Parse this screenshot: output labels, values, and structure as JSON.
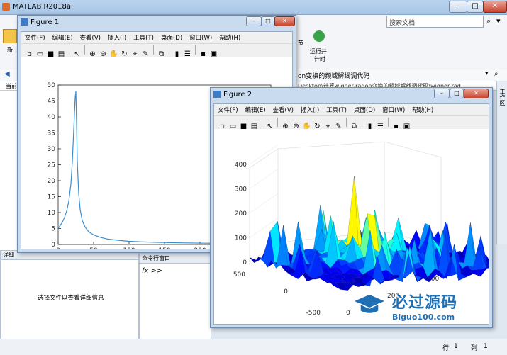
{
  "main": {
    "title": "MATLAB R2018a",
    "search_placeholder": "搜索文档",
    "ribbon_left_label": "新",
    "ribbon_right_1": "节",
    "ribbon_right_2": "运行并",
    "ribbon_right_3": "计时",
    "address_text": "on变换的频域解线调代码",
    "path_text": "Desktop\\计算wigner-radon变换的频域解线调代码\\wigner-rad",
    "current_folder_label": "当前",
    "detail_label": "详细",
    "detail_message": "选择文件以查看详细信息",
    "command_window_label": "命令行窗口",
    "prompt": "fx >>",
    "workspace_tab": "工作区",
    "status_row_label": "行",
    "status_row_value": "1",
    "status_col_label": "列",
    "status_col_value": "1",
    "watermark_brand": "必过源码",
    "watermark_url": "Biguo100.com"
  },
  "figure1": {
    "title": "Figure 1",
    "menus": [
      "文件(F)",
      "编辑(E)",
      "查看(V)",
      "插入(I)",
      "工具(T)",
      "桌面(D)",
      "窗口(W)",
      "帮助(H)"
    ]
  },
  "figure2": {
    "title": "Figure 2",
    "menus": [
      "文件(F)",
      "编辑(E)",
      "查看(V)",
      "插入(I)",
      "工具(T)",
      "桌面(D)",
      "窗口(W)",
      "帮助(H)"
    ]
  },
  "chart_data": [
    {
      "type": "line",
      "title": "",
      "xlabel": "",
      "ylabel": "",
      "xlim": [
        0,
        300
      ],
      "ylim": [
        0,
        50
      ],
      "xticks": [
        0,
        50,
        100,
        150,
        200
      ],
      "yticks": [
        0,
        5,
        10,
        15,
        20,
        25,
        30,
        35,
        40,
        45,
        50
      ],
      "color": "#3a8fd0",
      "x": [
        0,
        3,
        6,
        9,
        12,
        15,
        18,
        20,
        22,
        24,
        25,
        26,
        27,
        29,
        31,
        34,
        38,
        43,
        50,
        60,
        70,
        85,
        100,
        120,
        150,
        180,
        210,
        240
      ],
      "y": [
        5,
        6,
        7,
        8.5,
        10.5,
        13.5,
        19,
        26,
        36,
        46,
        48,
        38,
        26,
        16,
        11,
        7.5,
        5.5,
        4,
        3,
        2.2,
        1.7,
        1.3,
        1.0,
        0.8,
        0.6,
        0.5,
        0.4,
        0.35
      ]
    },
    {
      "type": "surface",
      "title": "",
      "zticks": [
        0,
        100,
        200,
        300,
        400
      ],
      "yticks": [
        500,
        0,
        -500
      ],
      "xticks": [
        0,
        200,
        400,
        600
      ],
      "zlim": [
        0,
        400
      ],
      "colormap": "jet",
      "peak_max": 370
    }
  ]
}
